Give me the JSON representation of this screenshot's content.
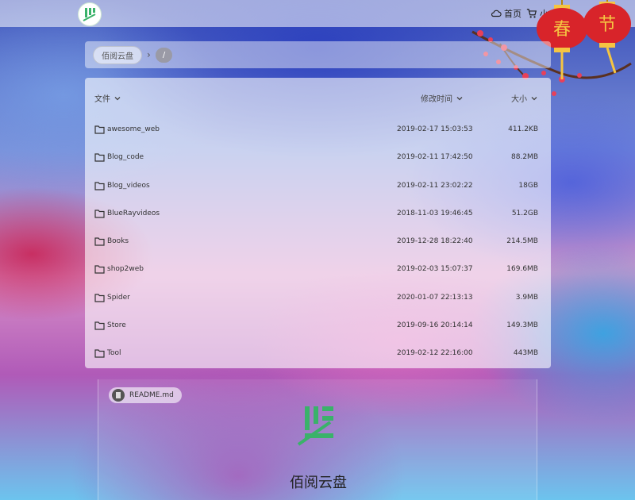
{
  "header": {
    "nav": [
      {
        "icon": "cloud-icon",
        "label": "首页"
      },
      {
        "icon": "cart-icon",
        "label": "小"
      }
    ]
  },
  "breadcrumb": {
    "root": "佰阅云盘",
    "separator": "›",
    "current": "/"
  },
  "table": {
    "columns": {
      "name": "文件",
      "modified": "修改时间",
      "size": "大小"
    },
    "rows": [
      {
        "name": "awesome_web",
        "modified": "2019-02-17 15:03:53",
        "size": "411.2KB"
      },
      {
        "name": "Blog_code",
        "modified": "2019-02-11 17:42:50",
        "size": "88.2MB"
      },
      {
        "name": "Blog_videos",
        "modified": "2019-02-11 23:02:22",
        "size": "18GB"
      },
      {
        "name": "BlueRayvideos",
        "modified": "2018-11-03 19:46:45",
        "size": "51.2GB"
      },
      {
        "name": "Books",
        "modified": "2019-12-28 18:22:40",
        "size": "214.5MB"
      },
      {
        "name": "shop2web",
        "modified": "2019-02-03 15:07:37",
        "size": "169.6MB"
      },
      {
        "name": "Spider",
        "modified": "2020-01-07 22:13:13",
        "size": "3.9MB"
      },
      {
        "name": "Store",
        "modified": "2019-09-16 20:14:14",
        "size": "149.3MB"
      },
      {
        "name": "Tool",
        "modified": "2019-02-12 22:16:00",
        "size": "443MB"
      }
    ]
  },
  "readme": {
    "file_label": "README.md",
    "title": "佰阅云盘"
  },
  "decoration": {
    "lantern_1": "春",
    "lantern_2": "节"
  },
  "colors": {
    "brand_green": "#3ab26a",
    "lantern_red": "#d8242a",
    "lantern_gold": "#f5c542"
  }
}
